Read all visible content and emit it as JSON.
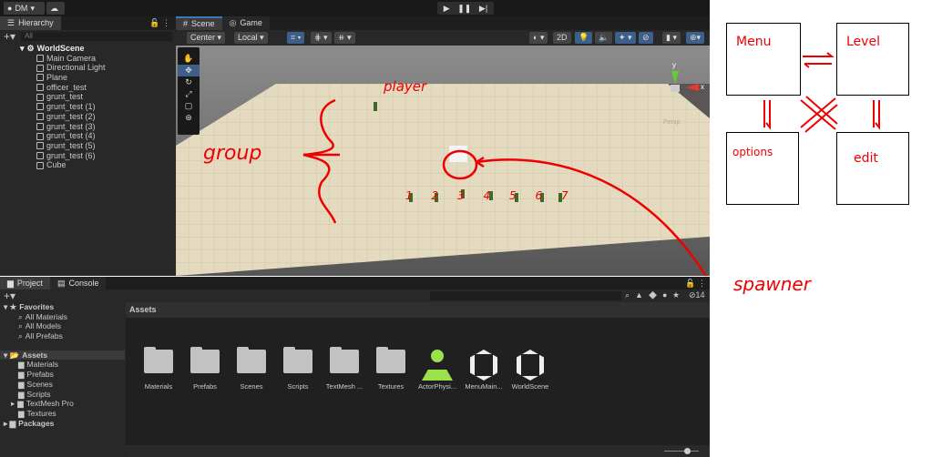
{
  "topbar": {
    "account": "DM",
    "play_icon": "play-icon",
    "pause_icon": "pause-icon",
    "step_icon": "step-icon"
  },
  "hierarchy": {
    "tab": "Hierarchy",
    "search_placeholder": "All",
    "scene": "WorldScene",
    "items": [
      "Main Camera",
      "Directional Light",
      "Plane",
      "officer_test",
      "grunt_test",
      "grunt_test (1)",
      "grunt_test (2)",
      "grunt_test (3)",
      "grunt_test (4)",
      "grunt_test (5)",
      "grunt_test (6)",
      "Cube"
    ]
  },
  "scene": {
    "tabs": [
      "Scene",
      "Game"
    ],
    "pivot": "Center",
    "space": "Local",
    "mode2d": "2D",
    "gizmo_y": "y",
    "gizmo_x": "x",
    "view": "Persp",
    "annotations": {
      "player": "player",
      "group": "group",
      "spawner": "spawner",
      "numbers": [
        "1",
        "2",
        "3",
        "4",
        "5",
        "6",
        "7"
      ]
    }
  },
  "project": {
    "tabs": [
      "Project",
      "Console"
    ],
    "hidden_count": "14",
    "breadcrumb": "Assets",
    "favorites": {
      "label": "Favorites",
      "items": [
        "All Materials",
        "All Models",
        "All Prefabs"
      ]
    },
    "assets": {
      "label": "Assets",
      "items": [
        "Materials",
        "Prefabs",
        "Scenes",
        "Scripts",
        "TextMesh Pro",
        "Textures"
      ]
    },
    "packages": "Packages",
    "grid": [
      {
        "name": "Materials",
        "type": "folder"
      },
      {
        "name": "Prefabs",
        "type": "folder"
      },
      {
        "name": "Scenes",
        "type": "folder"
      },
      {
        "name": "Scripts",
        "type": "folder"
      },
      {
        "name": "TextMesh ...",
        "type": "folder"
      },
      {
        "name": "Textures",
        "type": "folder"
      },
      {
        "name": "ActorPhysi...",
        "type": "physics"
      },
      {
        "name": "MenuMain...",
        "type": "unity"
      },
      {
        "name": "WorldScene",
        "type": "unity"
      }
    ]
  },
  "diagram": {
    "boxes": [
      "Menu",
      "Level",
      "options",
      "edit"
    ]
  },
  "colors": {
    "accent": "#3e5f8a",
    "annotation": "#e00000",
    "physics": "#9be24a"
  }
}
